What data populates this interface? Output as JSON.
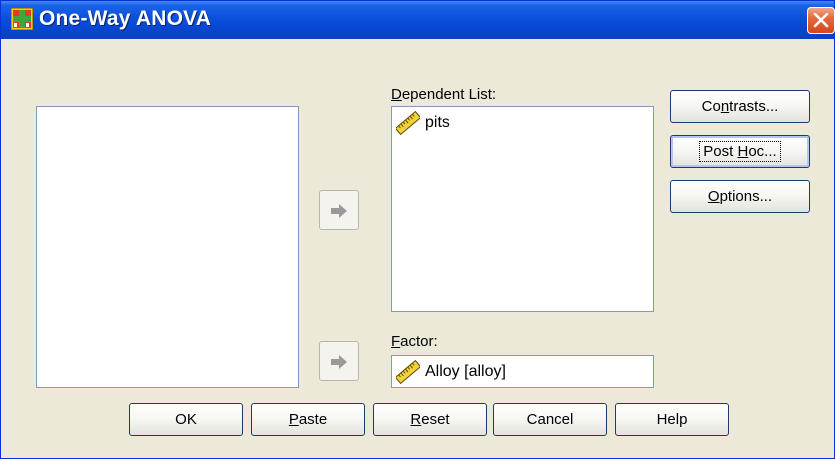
{
  "window": {
    "title": "One-Way ANOVA"
  },
  "labels": {
    "dependent_list": {
      "pre": "",
      "key": "D",
      "post": "ependent List:"
    },
    "factor": {
      "pre": "",
      "key": "F",
      "post": "actor:"
    }
  },
  "dependent_list": {
    "items": [
      {
        "label": "pits",
        "icon": "scale-ruler-icon"
      }
    ]
  },
  "factor": {
    "value": "Alloy [alloy]",
    "icon": "scale-ruler-icon"
  },
  "side_buttons": {
    "contrasts": {
      "pre": "Co",
      "key": "n",
      "post": "trasts..."
    },
    "post_hoc": {
      "pre": "Post ",
      "key": "H",
      "post": "oc..."
    },
    "options": {
      "pre": "",
      "key": "O",
      "post": "ptions..."
    }
  },
  "bottom_buttons": {
    "ok": "OK",
    "paste": {
      "pre": "",
      "key": "P",
      "post": "aste"
    },
    "reset": {
      "pre": "",
      "key": "R",
      "post": "eset"
    },
    "cancel": "Cancel",
    "help": "Help"
  },
  "colors": {
    "title_bar": "#0847d2",
    "dialog_bg": "#ece9d8",
    "close_button": "#d4471b"
  }
}
